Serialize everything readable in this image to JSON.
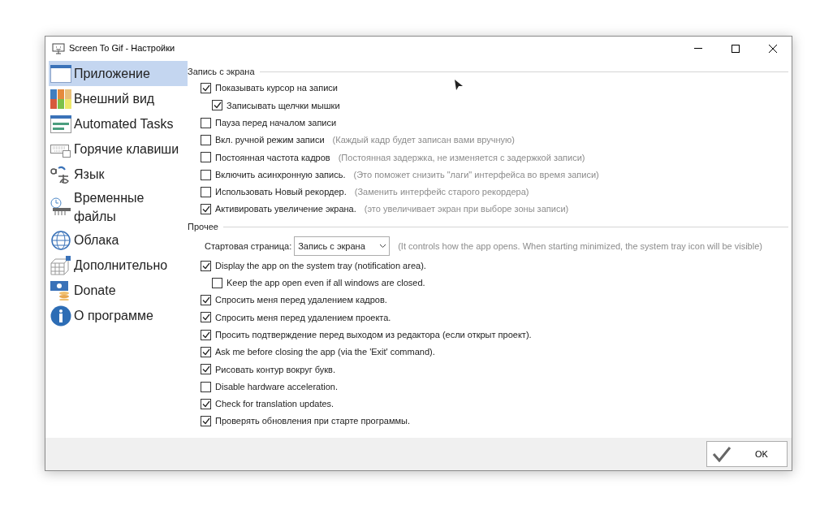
{
  "window": {
    "title": "Screen To Gif - Настройки"
  },
  "sidebar": {
    "items": [
      {
        "label": "Приложение",
        "selected": true
      },
      {
        "label": "Внешний вид",
        "selected": false
      },
      {
        "label": "Automated Tasks",
        "selected": false
      },
      {
        "label": "Горячие клавиши",
        "selected": false
      },
      {
        "label": "Язык",
        "selected": false
      },
      {
        "label": "Временные файлы",
        "selected": false
      },
      {
        "label": "Облака",
        "selected": false
      },
      {
        "label": "Дополнительно",
        "selected": false
      },
      {
        "label": "Donate",
        "selected": false
      },
      {
        "label": "О программе",
        "selected": false
      }
    ]
  },
  "sections": [
    {
      "title": "Запись с экрана",
      "options": [
        {
          "kind": "checkbox",
          "label": "Показывать курсор на записи",
          "checked": true,
          "children": [
            {
              "kind": "checkbox",
              "label": "Записывать щелчки мышки",
              "checked": true
            }
          ]
        },
        {
          "kind": "checkbox",
          "label": "Пауза перед началом записи",
          "checked": false
        },
        {
          "kind": "checkbox",
          "label": "Вкл. ручной режим записи",
          "note": "(Каждый кадр будет записан вами вручную)",
          "checked": false
        },
        {
          "kind": "checkbox",
          "label": "Постоянная частота кадров",
          "note": "(Постоянная задержка, не изменяется с задержкой записи)",
          "checked": false
        },
        {
          "kind": "checkbox",
          "label": "Включить асинхронную запись.",
          "note": "(Это поможет снизить \"лаги\" интерфейса во время записи)",
          "checked": false
        },
        {
          "kind": "checkbox",
          "label": "Использовать Новый рекордер.",
          "note": "(Заменить интерфейс старого рекордера)",
          "checked": false
        },
        {
          "kind": "checkbox",
          "label": "Активировать увеличение экрана.",
          "note": "(это увеличивает экран при выборе зоны записи)",
          "checked": true
        }
      ]
    },
    {
      "title": "Прочее",
      "options": [
        {
          "kind": "select",
          "label": "Стартовая страница:",
          "value": "Запись с экрана",
          "note": "(It controls how the app opens. When starting minimized, the system tray icon will be visible)"
        },
        {
          "kind": "checkbox",
          "label": "Display the app on the system tray (notification area).",
          "checked": true,
          "children": [
            {
              "kind": "checkbox",
              "label": "Keep the app open even if all windows are closed.",
              "checked": false
            }
          ]
        },
        {
          "kind": "checkbox",
          "label": "Спросить меня перед удалением кадров.",
          "checked": true
        },
        {
          "kind": "checkbox",
          "label": "Спросить меня перед удалением проекта.",
          "checked": true
        },
        {
          "kind": "checkbox",
          "label": "Просить подтверждение перед выходом из редактора (если открыт проект).",
          "checked": true
        },
        {
          "kind": "checkbox",
          "label": "Ask me before closing the app (via the 'Exit' command).",
          "checked": true
        },
        {
          "kind": "checkbox",
          "label": "Рисовать контур вокруг букв.",
          "checked": true
        },
        {
          "kind": "checkbox",
          "label": "Disable hardware acceleration.",
          "checked": false
        },
        {
          "kind": "checkbox",
          "label": "Check for translation updates.",
          "checked": true
        },
        {
          "kind": "checkbox",
          "label": "Проверять обновления при старте программы.",
          "checked": true
        }
      ]
    }
  ],
  "footer": {
    "ok_button": "OK"
  }
}
